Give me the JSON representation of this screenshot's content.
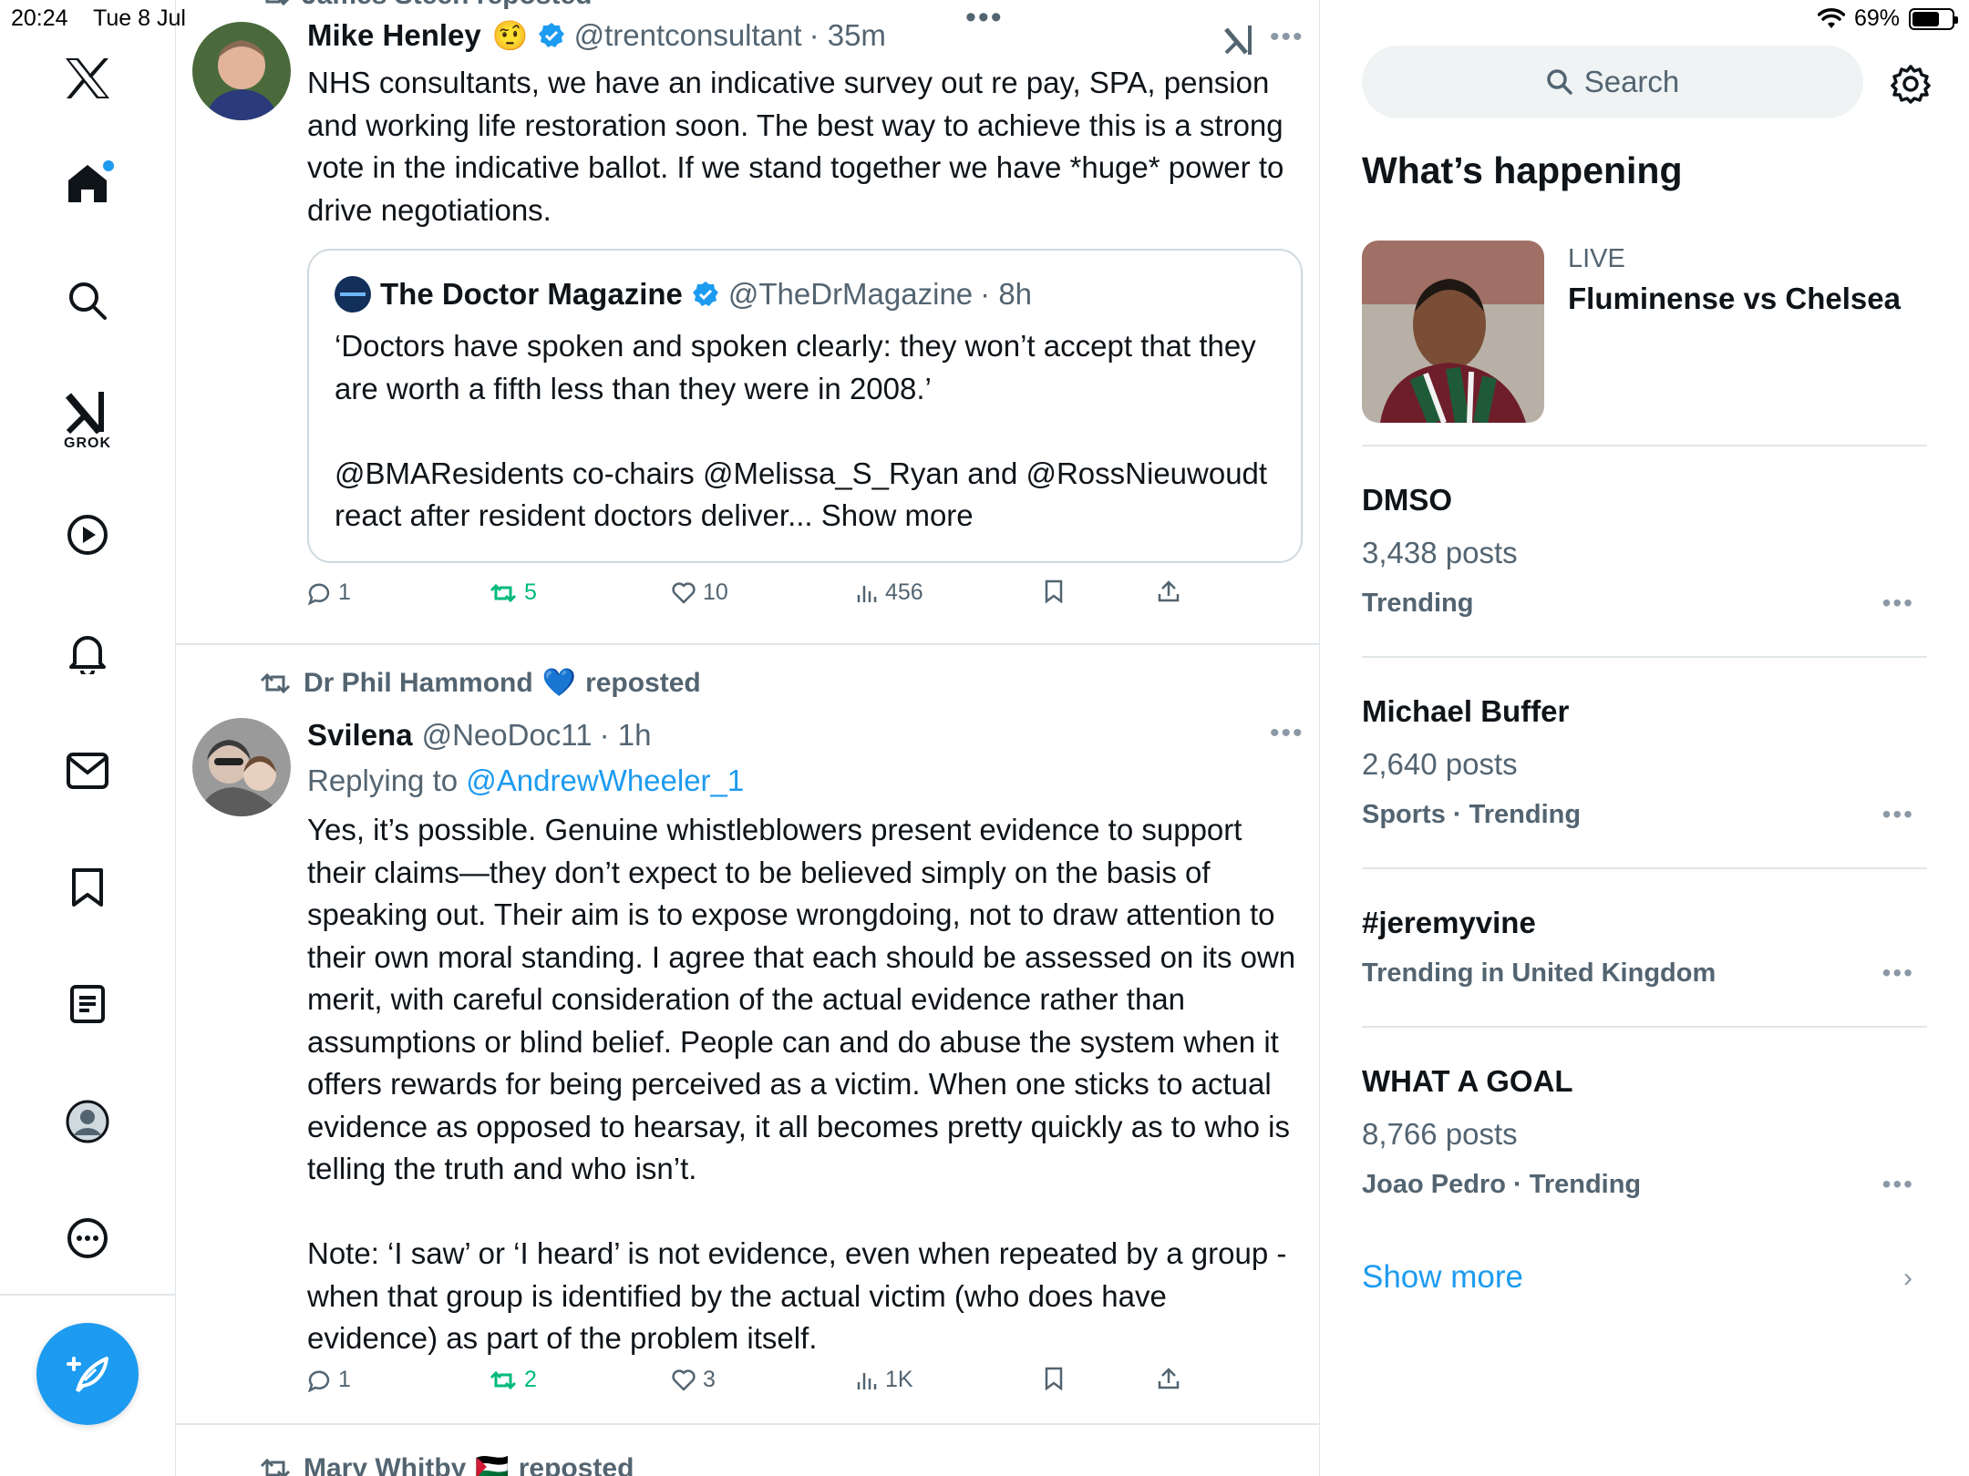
{
  "status_bar": {
    "time": "20:24",
    "date": "Tue 8 Jul",
    "battery": "69%",
    "battery_level": 0.69
  },
  "nav": {
    "items": [
      "x-logo",
      "home",
      "explore",
      "grok",
      "video",
      "notifications",
      "messages",
      "bookmarks",
      "lists",
      "profile",
      "more"
    ],
    "grok_label": "GROK"
  },
  "feed": {
    "top_post": {
      "repost_partial": "James Steen reposted",
      "name": "Mike Henley",
      "emoji": "🤨",
      "handle": "@trentconsultant",
      "time": "· 35m",
      "text": "NHS consultants, we have an indicative survey out re pay, SPA, pension and working life restoration soon. The best way to achieve this is a strong vote in the indicative ballot. If we stand together we have *huge* power to drive negotiations.",
      "quote": {
        "name": "The Doctor Magazine",
        "handle": "@TheDrMagazine",
        "time": "· 8h",
        "text": "‘Doctors have spoken and spoken clearly: they won’t accept that they are worth a fifth less than they were in 2008.’\n\n@BMAResidents co-chairs @Melissa_S_Ryan and @RossNieuwoudt react after resident doctors deliver... Show more"
      },
      "actions": {
        "replies": "1",
        "reposts": "5",
        "likes": "10",
        "views": "456"
      }
    },
    "second_post": {
      "repost_by": "Dr Phil Hammond",
      "repost_emoji": "💙",
      "repost_suffix": "reposted",
      "name": "Svilena",
      "handle": "@NeoDoc11",
      "time": "· 1h",
      "replying_prefix": "Replying to",
      "replying_to": "@AndrewWheeler_1",
      "text": "Yes, it’s possible. Genuine whistleblowers present evidence to support their claims—they don’t expect to be believed simply on the basis of speaking out. Their aim is to expose wrongdoing, not to draw attention to their own moral standing. I agree that each should be assessed on its own merit, with careful consideration of the actual evidence rather than assumptions or blind belief. People can and do abuse the system when it offers rewards for being perceived as a victim. When one sticks to actual evidence as opposed to hearsay, it all becomes pretty quickly as to who is telling the truth and who isn’t.\n\nNote: ‘I saw’ or ‘I heard’ is not evidence, even when repeated by a group - when that group is identified by the actual victim (who does have evidence) as part of the problem itself.",
      "actions": {
        "replies": "1",
        "reposts": "2",
        "likes": "3",
        "views": "1K"
      }
    },
    "third_post": {
      "repost_by": "Mary Whitby",
      "repost_emoji": "🇵🇸",
      "repost_suffix": "reposted"
    }
  },
  "right": {
    "search_placeholder": "Search",
    "title": "What’s happening",
    "live": {
      "label": "LIVE",
      "title": "Fluminense vs Chelsea"
    },
    "trends": [
      {
        "name": "DMSO",
        "posts": "3,438 posts",
        "meta": "Trending"
      },
      {
        "name": "Michael Buffer",
        "posts": "2,640 posts",
        "meta": "Sports · Trending"
      },
      {
        "name": "#jeremyvine",
        "posts": "",
        "meta": "Trending in United Kingdom"
      },
      {
        "name": "WHAT A GOAL",
        "posts": "8,766 posts",
        "meta": "Joao Pedro · Trending"
      }
    ],
    "show_more": "Show more"
  },
  "colors": {
    "accent": "#1d9bf0",
    "repost_green": "#00ba7c",
    "secondary_text": "#536471",
    "divider": "#e1e6ea"
  }
}
